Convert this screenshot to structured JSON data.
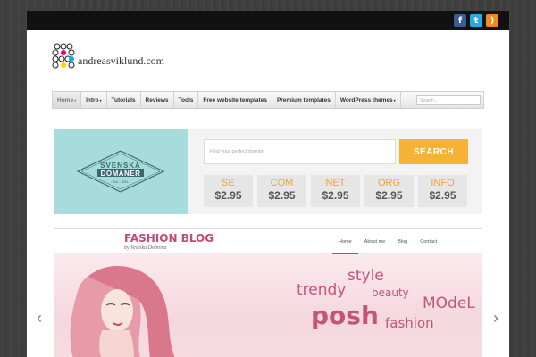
{
  "social": {
    "facebook": "f",
    "twitter": "t",
    "rss": ")"
  },
  "logo": {
    "site_name": "andreasviklund.com"
  },
  "nav": {
    "items": [
      {
        "label": "Home",
        "caret": "▾"
      },
      {
        "label": "Intro",
        "caret": "▾"
      },
      {
        "label": "Tutorials",
        "caret": ""
      },
      {
        "label": "Reviews",
        "caret": ""
      },
      {
        "label": "Tools",
        "caret": ""
      },
      {
        "label": "Free website templates",
        "caret": ""
      },
      {
        "label": "Premium templates",
        "caret": ""
      },
      {
        "label": "WordPress themes",
        "caret": "▾"
      }
    ],
    "search_placeholder": "Search..."
  },
  "domain": {
    "brand_line1": "SVENSKA",
    "brand_line2": "DOMÄNER",
    "brand_line3": "- Est. 1991 -",
    "input_placeholder": "Find your perfect domain",
    "search_label": "SEARCH",
    "tlds": [
      {
        "name": "SE",
        "price": "$2.95"
      },
      {
        "name": "COM",
        "price": "$2.95"
      },
      {
        "name": "NET",
        "price": "$2.95"
      },
      {
        "name": "ORG",
        "price": "$2.95"
      },
      {
        "name": "INFO",
        "price": "$2.95"
      }
    ],
    "colors": {
      "accent": "#f6b234",
      "panel": "#a6dcdc"
    }
  },
  "slide": {
    "title": "FASHION BLOG",
    "subtitle": "by Veselka Dobreva",
    "nav": [
      "Home",
      "About me",
      "Blog",
      "Contact"
    ],
    "words": {
      "style": "style",
      "trendy": "trendy",
      "beauty": "beauty",
      "posh": "posh",
      "model": "MOdeL",
      "fashion": "fashion"
    },
    "arrow_left": "‹",
    "arrow_right": "›"
  }
}
